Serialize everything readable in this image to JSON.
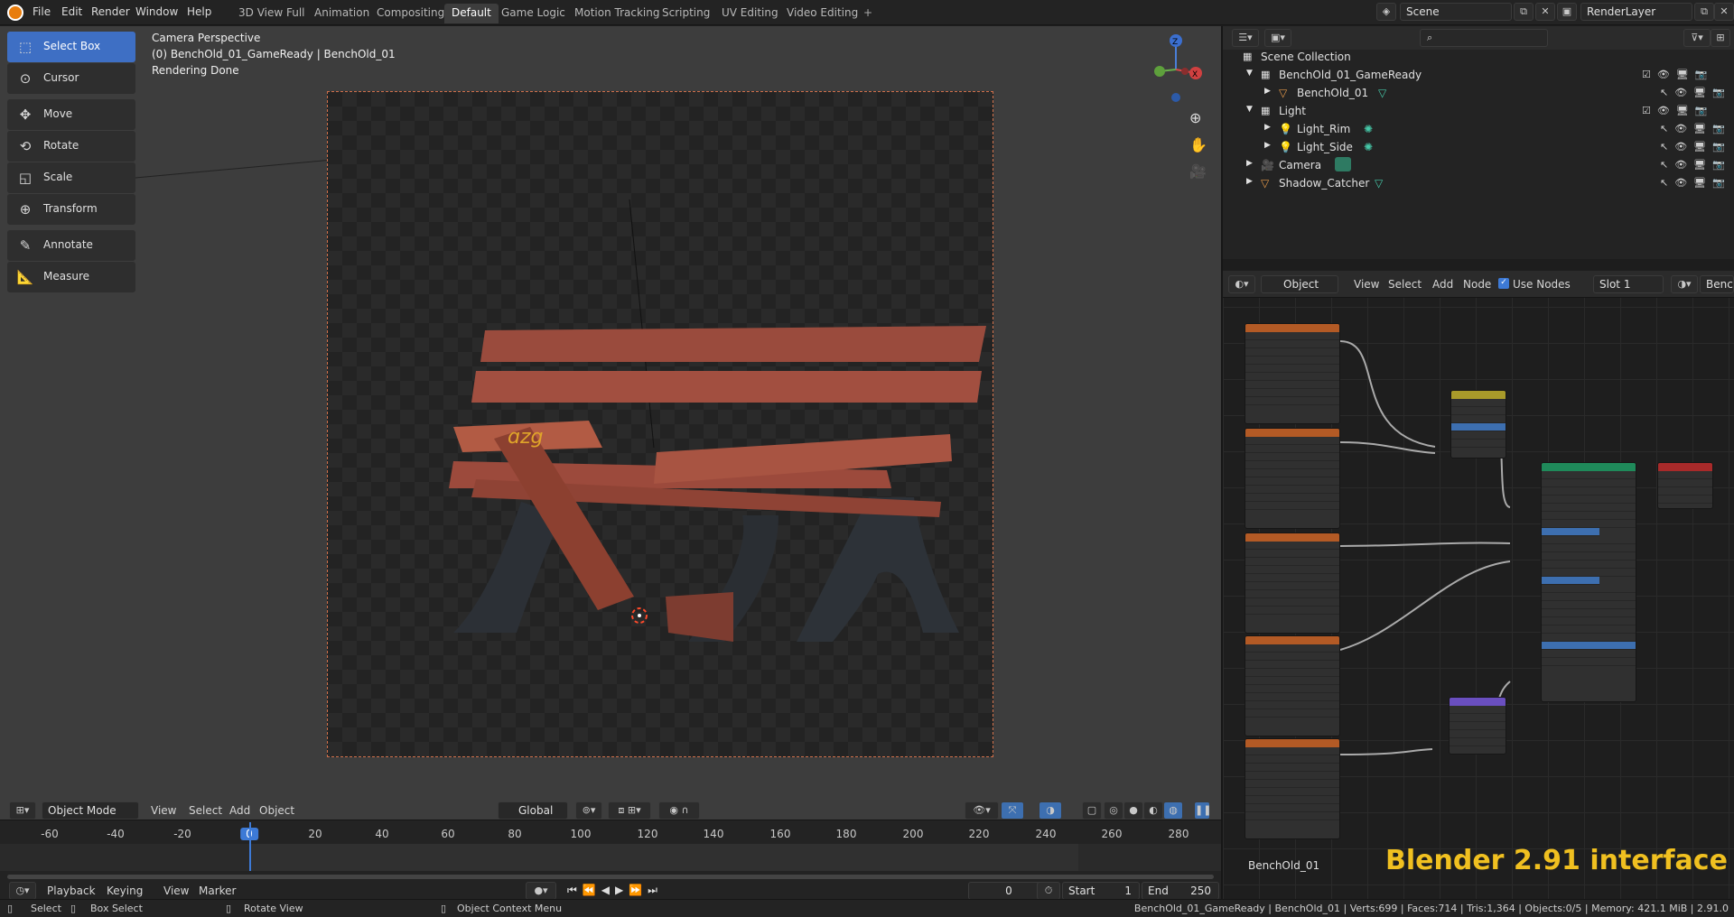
{
  "menu": {
    "file": "File",
    "edit": "Edit",
    "render": "Render",
    "window": "Window",
    "help": "Help"
  },
  "workspaces": [
    "3D View Full",
    "Animation",
    "Compositing",
    "Default",
    "Game Logic",
    "Motion Tracking",
    "Scripting",
    "UV Editing",
    "Video Editing"
  ],
  "workspace_active": "Default",
  "scene": {
    "name": "Scene",
    "render_layer": "RenderLayer"
  },
  "toolbar": [
    {
      "label": "Select Box",
      "icon": "select-box-icon",
      "active": true
    },
    {
      "label": "Cursor",
      "icon": "cursor-icon"
    },
    {
      "label": "Move",
      "icon": "move-icon"
    },
    {
      "label": "Rotate",
      "icon": "rotate-icon"
    },
    {
      "label": "Scale",
      "icon": "scale-icon"
    },
    {
      "label": "Transform",
      "icon": "transform-icon"
    },
    {
      "label": "Annotate",
      "icon": "annotate-icon"
    },
    {
      "label": "Measure",
      "icon": "measure-icon"
    }
  ],
  "viewport": {
    "info1": "Camera Perspective",
    "info2": "(0) BenchOld_01_GameReady | BenchOld_01",
    "info3": "Rendering Done",
    "mode": "Object Mode",
    "menus": [
      "View",
      "Select",
      "Add",
      "Object"
    ],
    "orientation": "Global"
  },
  "outliner": {
    "root": "Scene Collection",
    "rows": [
      {
        "label": "BenchOld_01_GameReady",
        "type": "collection"
      },
      {
        "label": "BenchOld_01",
        "type": "mesh"
      },
      {
        "label": "Light",
        "type": "collection"
      },
      {
        "label": "Light_Rim",
        "type": "light"
      },
      {
        "label": "Light_Side",
        "type": "light"
      },
      {
        "label": "Camera",
        "type": "camera"
      },
      {
        "label": "Shadow_Catcher",
        "type": "mesh"
      }
    ]
  },
  "node_editor": {
    "type": "Object",
    "menus": [
      "View",
      "Select",
      "Add",
      "Node"
    ],
    "use_nodes": "Use Nodes",
    "slot": "Slot 1",
    "material": "BenchO",
    "footer_name": "BenchOld_01",
    "watermark": "Blender 2.91 interface"
  },
  "timeline": {
    "menus": [
      "Playback",
      "Keying",
      "View",
      "Marker"
    ],
    "frame_labels": [
      "-60",
      "-40",
      "-20",
      "0",
      "20",
      "40",
      "60",
      "80",
      "100",
      "120",
      "140",
      "160",
      "180",
      "200",
      "220",
      "240",
      "260",
      "280"
    ],
    "current_frame": "0",
    "start_label": "Start",
    "start": "1",
    "end_label": "End",
    "end": "250"
  },
  "status": {
    "select": "Select",
    "box_select": "Box Select",
    "rotate_view": "Rotate View",
    "context_menu": "Object Context Menu",
    "stats": "BenchOld_01_GameReady | BenchOld_01 | Verts:699 | Faces:714 | Tris:1,364 | Objects:0/5 | Memory: 421.1 MiB | 2.91.0"
  }
}
